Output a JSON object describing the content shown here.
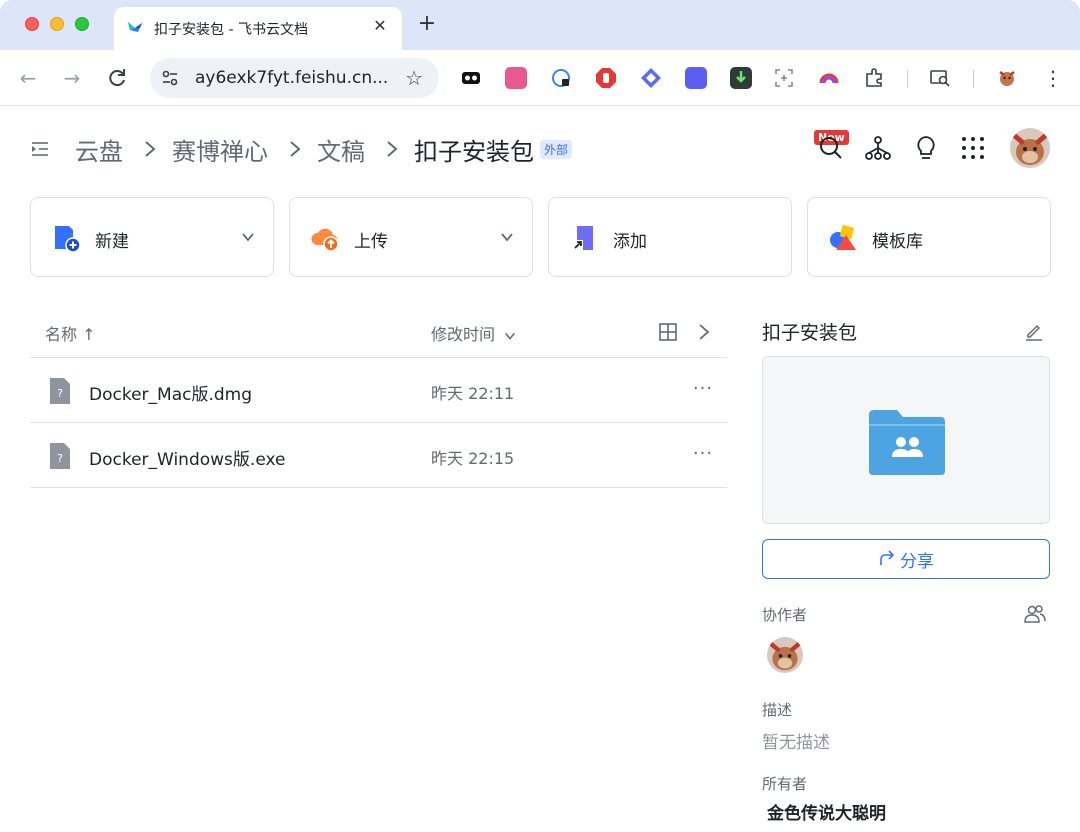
{
  "browser": {
    "tab_title": "扣子安装包 - 飞书云文档",
    "tab_close": "✕",
    "new_tab": "+",
    "url": "ay6exk7fyt.feishu.cn...",
    "extension_badge": "New",
    "icons": [
      "back-icon",
      "forward-icon",
      "reload-icon",
      "site-settings-icon",
      "star-icon",
      "menu-icon"
    ]
  },
  "breadcrumb": {
    "items": [
      "云盘",
      "赛博禅心",
      "文稿",
      "扣子安装包"
    ],
    "badge": "外部"
  },
  "actions": [
    {
      "label": "新建",
      "has_dropdown": true,
      "icon": "new-doc-icon"
    },
    {
      "label": "上传",
      "has_dropdown": true,
      "icon": "upload-cloud-icon"
    },
    {
      "label": "添加",
      "has_dropdown": false,
      "icon": "add-shortcut-icon"
    },
    {
      "label": "模板库",
      "has_dropdown": false,
      "icon": "template-icon"
    }
  ],
  "table": {
    "col_name": "名称 ↑",
    "col_time": "修改时间",
    "rows": [
      {
        "name": "Docker_Mac版.dmg",
        "time": "昨天 22:11",
        "more": "···"
      },
      {
        "name": "Docker_Windows版.exe",
        "time": "昨天 22:15",
        "more": "···"
      }
    ]
  },
  "panel": {
    "title": "扣子安装包",
    "share_label": "分享",
    "collaborators_label": "协作者",
    "description_label": "描述",
    "description_value": "暂无描述",
    "owner_label": "所有者",
    "owner_value": "金色传说大聪明"
  },
  "colors": {
    "accent": "#3370ff",
    "folder": "#4ea4e0",
    "tabstrip": "#dde6f8"
  }
}
